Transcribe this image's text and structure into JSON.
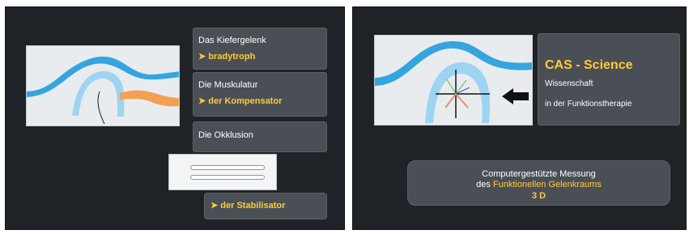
{
  "left_slide": {
    "panels": [
      {
        "title": "Das Kiefergelenk",
        "highlight": "➤ bradytroph"
      },
      {
        "title": "Die Muskulatur",
        "highlight": "➤ der Kompensator"
      },
      {
        "title": "Die Okklusion"
      }
    ],
    "stabilisator": "➤ der Stabilisator"
  },
  "right_slide": {
    "title": "CAS - Science",
    "subtitle_1": "Wissenschaft",
    "subtitle_2": "in der  Funktionstherapie",
    "measure": {
      "line_1": "Computergestützte Messung",
      "line_2_prefix": "des ",
      "line_2_highlight": "Funktionellen Gelenkraums",
      "line_3": "3 D"
    }
  },
  "colors": {
    "background": "#1f2328",
    "panel": "#4a4f56",
    "accent": "#ffcc33",
    "text": "#ffffff",
    "jaw_blue": "#35a5de",
    "light_blue": "#9fd3f2",
    "orange": "#f3a055",
    "arrow_black": "#111111"
  },
  "icons": {
    "arrow": "left-arrow-icon"
  }
}
